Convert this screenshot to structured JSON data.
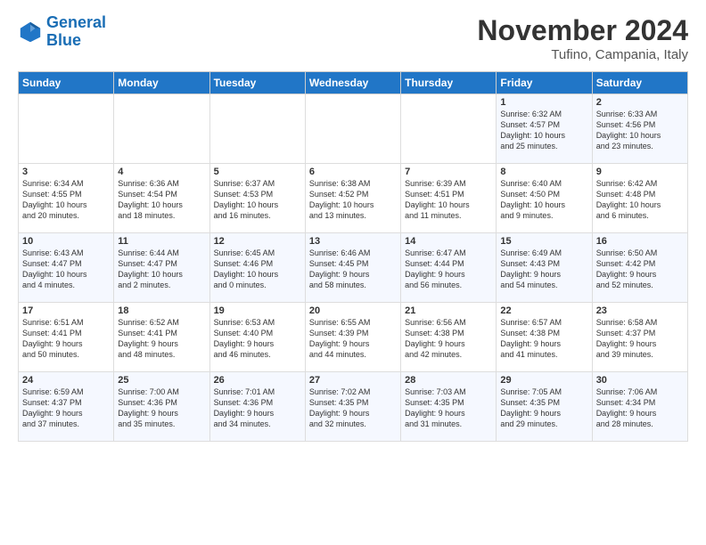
{
  "logo": {
    "line1": "General",
    "line2": "Blue"
  },
  "title": "November 2024",
  "subtitle": "Tufino, Campania, Italy",
  "headers": [
    "Sunday",
    "Monday",
    "Tuesday",
    "Wednesday",
    "Thursday",
    "Friday",
    "Saturday"
  ],
  "weeks": [
    [
      {
        "day": "",
        "text": ""
      },
      {
        "day": "",
        "text": ""
      },
      {
        "day": "",
        "text": ""
      },
      {
        "day": "",
        "text": ""
      },
      {
        "day": "",
        "text": ""
      },
      {
        "day": "1",
        "text": "Sunrise: 6:32 AM\nSunset: 4:57 PM\nDaylight: 10 hours\nand 25 minutes."
      },
      {
        "day": "2",
        "text": "Sunrise: 6:33 AM\nSunset: 4:56 PM\nDaylight: 10 hours\nand 23 minutes."
      }
    ],
    [
      {
        "day": "3",
        "text": "Sunrise: 6:34 AM\nSunset: 4:55 PM\nDaylight: 10 hours\nand 20 minutes."
      },
      {
        "day": "4",
        "text": "Sunrise: 6:36 AM\nSunset: 4:54 PM\nDaylight: 10 hours\nand 18 minutes."
      },
      {
        "day": "5",
        "text": "Sunrise: 6:37 AM\nSunset: 4:53 PM\nDaylight: 10 hours\nand 16 minutes."
      },
      {
        "day": "6",
        "text": "Sunrise: 6:38 AM\nSunset: 4:52 PM\nDaylight: 10 hours\nand 13 minutes."
      },
      {
        "day": "7",
        "text": "Sunrise: 6:39 AM\nSunset: 4:51 PM\nDaylight: 10 hours\nand 11 minutes."
      },
      {
        "day": "8",
        "text": "Sunrise: 6:40 AM\nSunset: 4:50 PM\nDaylight: 10 hours\nand 9 minutes."
      },
      {
        "day": "9",
        "text": "Sunrise: 6:42 AM\nSunset: 4:48 PM\nDaylight: 10 hours\nand 6 minutes."
      }
    ],
    [
      {
        "day": "10",
        "text": "Sunrise: 6:43 AM\nSunset: 4:47 PM\nDaylight: 10 hours\nand 4 minutes."
      },
      {
        "day": "11",
        "text": "Sunrise: 6:44 AM\nSunset: 4:47 PM\nDaylight: 10 hours\nand 2 minutes."
      },
      {
        "day": "12",
        "text": "Sunrise: 6:45 AM\nSunset: 4:46 PM\nDaylight: 10 hours\nand 0 minutes."
      },
      {
        "day": "13",
        "text": "Sunrise: 6:46 AM\nSunset: 4:45 PM\nDaylight: 9 hours\nand 58 minutes."
      },
      {
        "day": "14",
        "text": "Sunrise: 6:47 AM\nSunset: 4:44 PM\nDaylight: 9 hours\nand 56 minutes."
      },
      {
        "day": "15",
        "text": "Sunrise: 6:49 AM\nSunset: 4:43 PM\nDaylight: 9 hours\nand 54 minutes."
      },
      {
        "day": "16",
        "text": "Sunrise: 6:50 AM\nSunset: 4:42 PM\nDaylight: 9 hours\nand 52 minutes."
      }
    ],
    [
      {
        "day": "17",
        "text": "Sunrise: 6:51 AM\nSunset: 4:41 PM\nDaylight: 9 hours\nand 50 minutes."
      },
      {
        "day": "18",
        "text": "Sunrise: 6:52 AM\nSunset: 4:41 PM\nDaylight: 9 hours\nand 48 minutes."
      },
      {
        "day": "19",
        "text": "Sunrise: 6:53 AM\nSunset: 4:40 PM\nDaylight: 9 hours\nand 46 minutes."
      },
      {
        "day": "20",
        "text": "Sunrise: 6:55 AM\nSunset: 4:39 PM\nDaylight: 9 hours\nand 44 minutes."
      },
      {
        "day": "21",
        "text": "Sunrise: 6:56 AM\nSunset: 4:38 PM\nDaylight: 9 hours\nand 42 minutes."
      },
      {
        "day": "22",
        "text": "Sunrise: 6:57 AM\nSunset: 4:38 PM\nDaylight: 9 hours\nand 41 minutes."
      },
      {
        "day": "23",
        "text": "Sunrise: 6:58 AM\nSunset: 4:37 PM\nDaylight: 9 hours\nand 39 minutes."
      }
    ],
    [
      {
        "day": "24",
        "text": "Sunrise: 6:59 AM\nSunset: 4:37 PM\nDaylight: 9 hours\nand 37 minutes."
      },
      {
        "day": "25",
        "text": "Sunrise: 7:00 AM\nSunset: 4:36 PM\nDaylight: 9 hours\nand 35 minutes."
      },
      {
        "day": "26",
        "text": "Sunrise: 7:01 AM\nSunset: 4:36 PM\nDaylight: 9 hours\nand 34 minutes."
      },
      {
        "day": "27",
        "text": "Sunrise: 7:02 AM\nSunset: 4:35 PM\nDaylight: 9 hours\nand 32 minutes."
      },
      {
        "day": "28",
        "text": "Sunrise: 7:03 AM\nSunset: 4:35 PM\nDaylight: 9 hours\nand 31 minutes."
      },
      {
        "day": "29",
        "text": "Sunrise: 7:05 AM\nSunset: 4:35 PM\nDaylight: 9 hours\nand 29 minutes."
      },
      {
        "day": "30",
        "text": "Sunrise: 7:06 AM\nSunset: 4:34 PM\nDaylight: 9 hours\nand 28 minutes."
      }
    ]
  ]
}
